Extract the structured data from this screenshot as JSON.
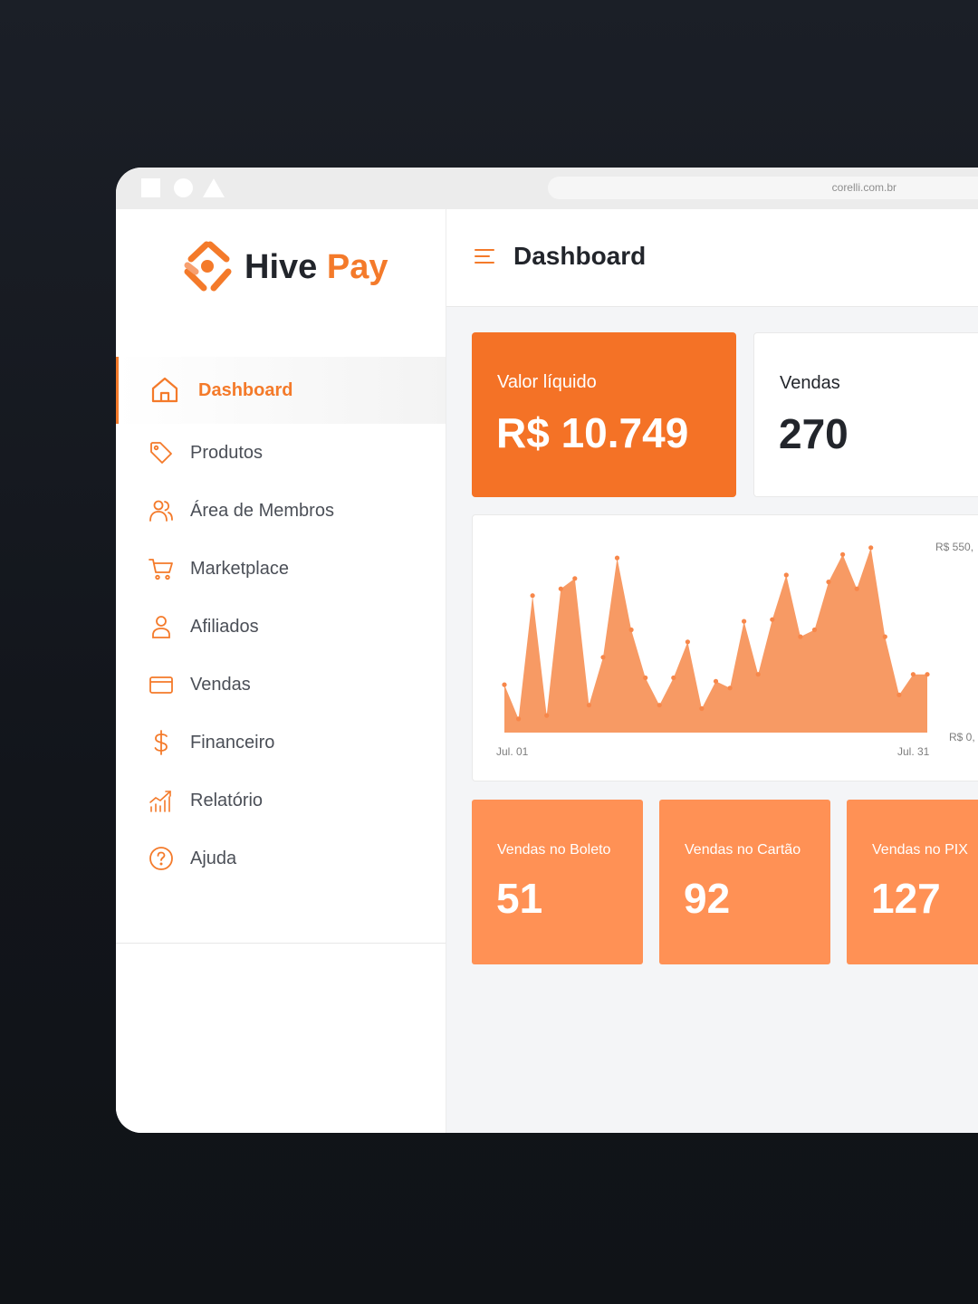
{
  "browser": {
    "url": "corelli.com.br"
  },
  "brand": {
    "name_part1": "Hive",
    "name_part2": "Pay",
    "accent_color": "#f47a2a"
  },
  "sidebar": {
    "items": [
      {
        "label": "Dashboard",
        "icon": "home-icon",
        "active": true
      },
      {
        "label": "Produtos",
        "icon": "tag-icon"
      },
      {
        "label": "Área de Membros",
        "icon": "users-icon"
      },
      {
        "label": "Marketplace",
        "icon": "cart-icon"
      },
      {
        "label": "Afiliados",
        "icon": "user-icon"
      },
      {
        "label": "Vendas",
        "icon": "credit-card-icon"
      },
      {
        "label": "Financeiro",
        "icon": "dollar-icon"
      },
      {
        "label": "Relatório",
        "icon": "chart-icon"
      },
      {
        "label": "Ajuda",
        "icon": "help-icon"
      }
    ]
  },
  "header": {
    "title": "Dashboard"
  },
  "cards": {
    "net_value": {
      "label": "Valor líquido",
      "value": "R$ 10.749"
    },
    "sales": {
      "label": "Vendas",
      "value": "270"
    }
  },
  "chart_data": {
    "type": "area",
    "x_start_label": "Jul. 01",
    "x_end_label": "Jul. 31",
    "y_max_label": "R$ 550,",
    "y_min_label": "R$ 0,",
    "ylim": [
      0,
      550
    ],
    "x": [
      1,
      2,
      3,
      4,
      5,
      6,
      7,
      8,
      9,
      10,
      11,
      12,
      13,
      14,
      15,
      16,
      17,
      18,
      19,
      20,
      21,
      22,
      23,
      24,
      25,
      26,
      27,
      28,
      29,
      30,
      31
    ],
    "values": [
      140,
      40,
      400,
      50,
      420,
      450,
      80,
      220,
      510,
      300,
      160,
      80,
      160,
      265,
      70,
      150,
      130,
      325,
      170,
      330,
      460,
      280,
      300,
      440,
      520,
      420,
      540,
      280,
      110,
      170,
      170
    ],
    "color": "#f79a64"
  },
  "payment_cards": [
    {
      "label": "Vendas no Boleto",
      "value": "51"
    },
    {
      "label": "Vendas no Cartão",
      "value": "92"
    },
    {
      "label": "Vendas no PIX",
      "value": "127"
    }
  ]
}
